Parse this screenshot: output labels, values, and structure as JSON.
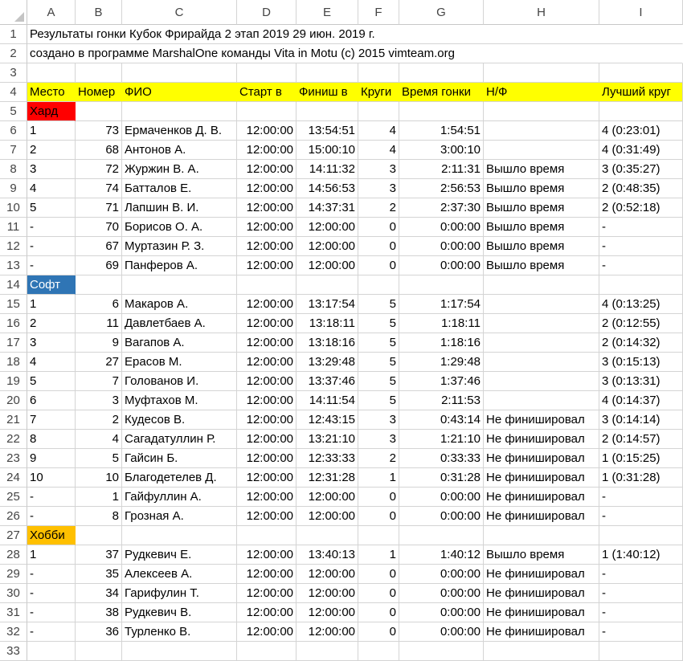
{
  "colors": {
    "header_fill": "#ffff00",
    "hard": "#ff0000",
    "soft": "#2f75b5",
    "hobby": "#ffc000"
  },
  "columns": [
    "A",
    "B",
    "C",
    "D",
    "E",
    "F",
    "G",
    "H",
    "I"
  ],
  "title_line": "Результаты гонки Кубок Фрирайда 2 этап 2019 29 июн. 2019 г.",
  "credit_line": "создано в программе MarshalOne команды Vita in Motu (c) 2015   vimteam.org",
  "headers": [
    "Место",
    "Номер",
    "ФИО",
    "Старт в",
    "Финиш в",
    "Круги",
    "Время гонки",
    "Н/Ф",
    "Лучший круг"
  ],
  "groups": [
    {
      "name": "Хард",
      "rows": [
        [
          "1",
          "73",
          "Ермаченков Д. В.",
          "12:00:00",
          "13:54:51",
          "4",
          "1:54:51",
          "",
          "4 (0:23:01)"
        ],
        [
          "2",
          "68",
          "Антонов А.",
          "12:00:00",
          "15:00:10",
          "4",
          "3:00:10",
          "",
          "4 (0:31:49)"
        ],
        [
          "3",
          "72",
          "Журжин В. А.",
          "12:00:00",
          "14:11:32",
          "3",
          "2:11:31",
          "Вышло время",
          "3 (0:35:27)"
        ],
        [
          "4",
          "74",
          "Батталов Е.",
          "12:00:00",
          "14:56:53",
          "3",
          "2:56:53",
          "Вышло время",
          "2 (0:48:35)"
        ],
        [
          "5",
          "71",
          "Лапшин В. И.",
          "12:00:00",
          "14:37:31",
          "2",
          "2:37:30",
          "Вышло время",
          "2 (0:52:18)"
        ],
        [
          "-",
          "70",
          "Борисов О. А.",
          "12:00:00",
          "12:00:00",
          "0",
          "0:00:00",
          "Вышло время",
          "-"
        ],
        [
          "-",
          "67",
          "Муртазин Р. З.",
          "12:00:00",
          "12:00:00",
          "0",
          "0:00:00",
          "Вышло время",
          "-"
        ],
        [
          "-",
          "69",
          "Панферов А.",
          "12:00:00",
          "12:00:00",
          "0",
          "0:00:00",
          "Вышло время",
          "-"
        ]
      ]
    },
    {
      "name": "Софт",
      "rows": [
        [
          "1",
          "6",
          "Макаров А.",
          "12:00:00",
          "13:17:54",
          "5",
          "1:17:54",
          "",
          "4 (0:13:25)"
        ],
        [
          "2",
          "11",
          "Давлетбаев А.",
          "12:00:00",
          "13:18:11",
          "5",
          "1:18:11",
          "",
          "2 (0:12:55)"
        ],
        [
          "3",
          "9",
          "Вагапов А.",
          "12:00:00",
          "13:18:16",
          "5",
          "1:18:16",
          "",
          "2 (0:14:32)"
        ],
        [
          "4",
          "27",
          "Ерасов М.",
          "12:00:00",
          "13:29:48",
          "5",
          "1:29:48",
          "",
          "3 (0:15:13)"
        ],
        [
          "5",
          "7",
          "Голованов И.",
          "12:00:00",
          "13:37:46",
          "5",
          "1:37:46",
          "",
          "3 (0:13:31)"
        ],
        [
          "6",
          "3",
          "Муфтахов М.",
          "12:00:00",
          "14:11:54",
          "5",
          "2:11:53",
          "",
          "4 (0:14:37)"
        ],
        [
          "7",
          "2",
          "Кудесов В.",
          "12:00:00",
          "12:43:15",
          "3",
          "0:43:14",
          "Не финишировал",
          "3 (0:14:14)"
        ],
        [
          "8",
          "4",
          "Сагадатуллин Р.",
          "12:00:00",
          "13:21:10",
          "3",
          "1:21:10",
          "Не финишировал",
          "2 (0:14:57)"
        ],
        [
          "9",
          "5",
          "Гайсин Б.",
          "12:00:00",
          "12:33:33",
          "2",
          "0:33:33",
          "Не финишировал",
          "1 (0:15:25)"
        ],
        [
          "10",
          "10",
          "Благодетелев Д.",
          "12:00:00",
          "12:31:28",
          "1",
          "0:31:28",
          "Не финишировал",
          "1 (0:31:28)"
        ],
        [
          "-",
          "1",
          "Гайфуллин А.",
          "12:00:00",
          "12:00:00",
          "0",
          "0:00:00",
          "Не финишировал",
          "-"
        ],
        [
          "-",
          "8",
          "Грозная А.",
          "12:00:00",
          "12:00:00",
          "0",
          "0:00:00",
          "Не финишировал",
          "-"
        ]
      ]
    },
    {
      "name": "Хобби",
      "rows": [
        [
          "1",
          "37",
          "Рудкевич Е.",
          "12:00:00",
          "13:40:13",
          "1",
          "1:40:12",
          "Вышло время",
          "1 (1:40:12)"
        ],
        [
          "-",
          "35",
          "Алексеев А.",
          "12:00:00",
          "12:00:00",
          "0",
          "0:00:00",
          "Не финишировал",
          "-"
        ],
        [
          "-",
          "34",
          "Гарифулин Т.",
          "12:00:00",
          "12:00:00",
          "0",
          "0:00:00",
          "Не финишировал",
          "-"
        ],
        [
          "-",
          "38",
          "Рудкевич В.",
          "12:00:00",
          "12:00:00",
          "0",
          "0:00:00",
          "Не финишировал",
          "-"
        ],
        [
          "-",
          "36",
          "Турленко В.",
          "12:00:00",
          "12:00:00",
          "0",
          "0:00:00",
          "Не финишировал",
          "-"
        ]
      ]
    }
  ]
}
